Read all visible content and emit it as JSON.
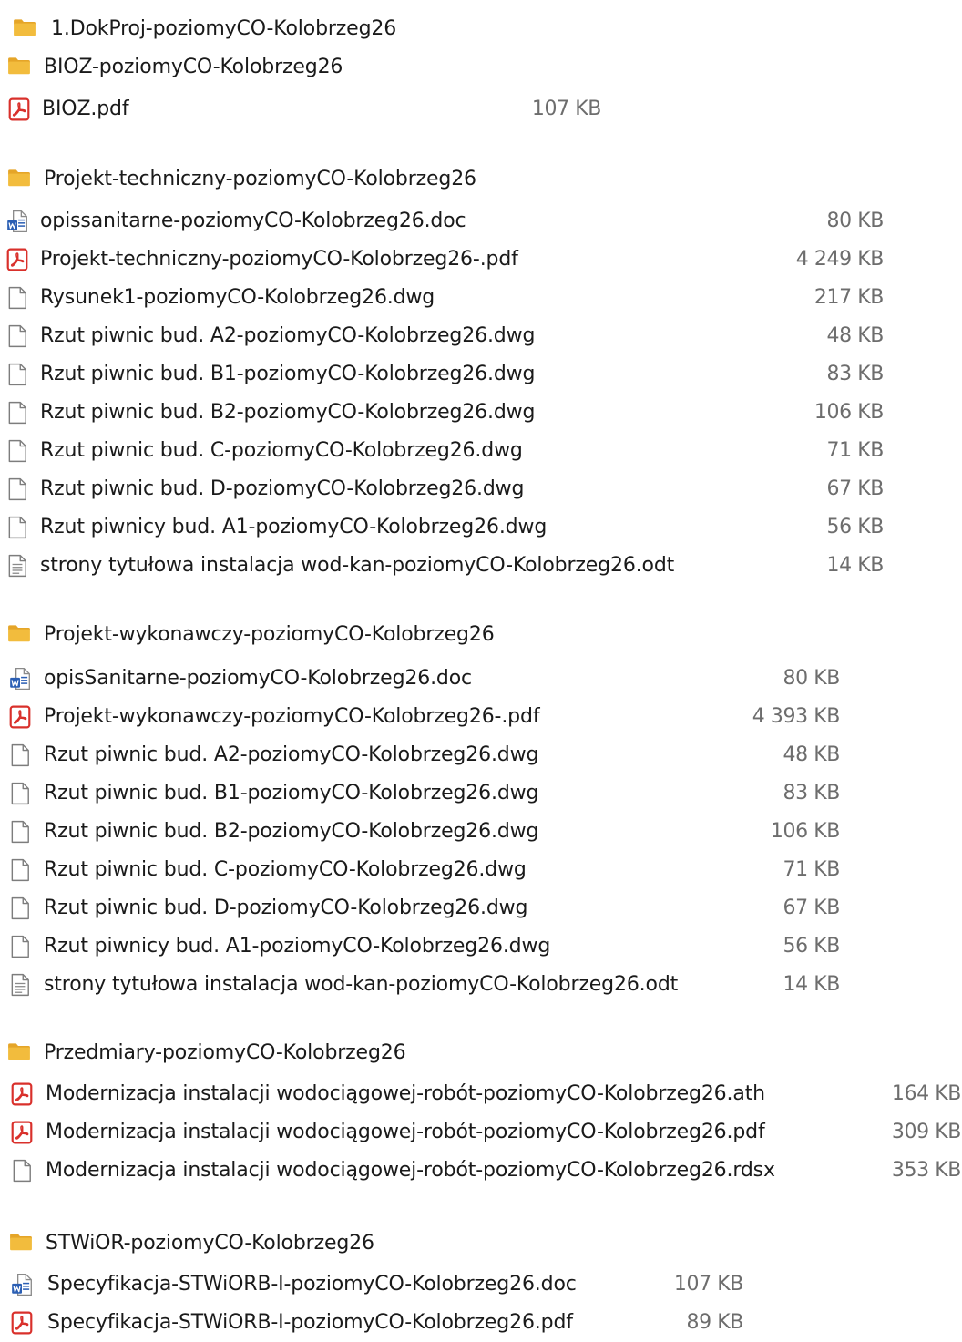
{
  "colors": {
    "folder": "#f2bc3d",
    "folder_tab": "#e5a528",
    "pdf_red": "#d9302b",
    "word_blue": "#2b5fb4",
    "size_gray": "#6d6d6d"
  },
  "groups": [
    {
      "folder": "1.DokProj-poziomyCO-Kolobrzeg26",
      "files": []
    },
    {
      "folder": "BIOZ-poziomyCO-Kolobrzeg26",
      "files": [
        {
          "name": "BIOZ.pdf",
          "size": "107 KB",
          "icon": "pdf-icon"
        }
      ]
    },
    {
      "folder": "Projekt-techniczny-poziomyCO-Kolobrzeg26",
      "files": [
        {
          "name": "opissanitarne-poziomyCO-Kolobrzeg26.doc",
          "size": "80 KB",
          "icon": "word-doc-icon"
        },
        {
          "name": "Projekt-techniczny-poziomyCO-Kolobrzeg26-.pdf",
          "size": "4 249 KB",
          "icon": "pdf-icon"
        },
        {
          "name": "Rysunek1-poziomyCO-Kolobrzeg26.dwg",
          "size": "217 KB",
          "icon": "blank-file-icon"
        },
        {
          "name": "Rzut piwnic bud. A2-poziomyCO-Kolobrzeg26.dwg",
          "size": "48 KB",
          "icon": "blank-file-icon"
        },
        {
          "name": "Rzut piwnic bud. B1-poziomyCO-Kolobrzeg26.dwg",
          "size": "83 KB",
          "icon": "blank-file-icon"
        },
        {
          "name": "Rzut piwnic bud. B2-poziomyCO-Kolobrzeg26.dwg",
          "size": "106 KB",
          "icon": "blank-file-icon"
        },
        {
          "name": "Rzut piwnic bud. C-poziomyCO-Kolobrzeg26.dwg",
          "size": "71 KB",
          "icon": "blank-file-icon"
        },
        {
          "name": "Rzut piwnic bud. D-poziomyCO-Kolobrzeg26.dwg",
          "size": "67 KB",
          "icon": "blank-file-icon"
        },
        {
          "name": "Rzut piwnicy bud. A1-poziomyCO-Kolobrzeg26.dwg",
          "size": "56 KB",
          "icon": "blank-file-icon"
        },
        {
          "name": "strony tytułowa instalacja wod-kan-poziomyCO-Kolobrzeg26.odt",
          "size": "14 KB",
          "icon": "text-document-icon"
        }
      ]
    },
    {
      "folder": "Projekt-wykonawczy-poziomyCO-Kolobrzeg26",
      "files": [
        {
          "name": "opisSanitarne-poziomyCO-Kolobrzeg26.doc",
          "size": "80 KB",
          "icon": "word-doc-icon"
        },
        {
          "name": "Projekt-wykonawczy-poziomyCO-Kolobrzeg26-.pdf",
          "size": "4 393 KB",
          "icon": "pdf-icon"
        },
        {
          "name": "Rzut piwnic bud. A2-poziomyCO-Kolobrzeg26.dwg",
          "size": "48 KB",
          "icon": "blank-file-icon"
        },
        {
          "name": "Rzut piwnic bud. B1-poziomyCO-Kolobrzeg26.dwg",
          "size": "83 KB",
          "icon": "blank-file-icon"
        },
        {
          "name": "Rzut piwnic bud. B2-poziomyCO-Kolobrzeg26.dwg",
          "size": "106 KB",
          "icon": "blank-file-icon"
        },
        {
          "name": "Rzut piwnic bud. C-poziomyCO-Kolobrzeg26.dwg",
          "size": "71 KB",
          "icon": "blank-file-icon"
        },
        {
          "name": "Rzut piwnic bud. D-poziomyCO-Kolobrzeg26.dwg",
          "size": "67 KB",
          "icon": "blank-file-icon"
        },
        {
          "name": "Rzut piwnicy bud. A1-poziomyCO-Kolobrzeg26.dwg",
          "size": "56 KB",
          "icon": "blank-file-icon"
        },
        {
          "name": "strony tytułowa instalacja wod-kan-poziomyCO-Kolobrzeg26.odt",
          "size": "14 KB",
          "icon": "text-document-icon"
        }
      ]
    },
    {
      "folder": "Przedmiary-poziomyCO-Kolobrzeg26",
      "files": [
        {
          "name": "Modernizacja  instalacji wodociągowej-robót-poziomyCO-Kolobrzeg26.ath",
          "size": "164 KB",
          "icon": "pdf-icon"
        },
        {
          "name": "Modernizacja  instalacji wodociągowej-robót-poziomyCO-Kolobrzeg26.pdf",
          "size": "309 KB",
          "icon": "pdf-icon"
        },
        {
          "name": "Modernizacja  instalacji wodociągowej-robót-poziomyCO-Kolobrzeg26.rdsx",
          "size": "353 KB",
          "icon": "blank-file-icon"
        }
      ]
    },
    {
      "folder": "STWiOR-poziomyCO-Kolobrzeg26",
      "files": [
        {
          "name": "Specyfikacja-STWiORB-I-poziomyCO-Kolobrzeg26.doc",
          "size": "107 KB",
          "icon": "word-doc-icon"
        },
        {
          "name": "Specyfikacja-STWiORB-I-poziomyCO-Kolobrzeg26.pdf",
          "size": "89 KB",
          "icon": "pdf-icon"
        }
      ]
    }
  ]
}
